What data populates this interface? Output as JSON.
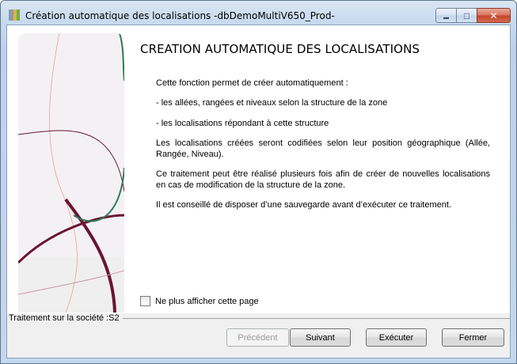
{
  "window": {
    "title": "Création automatique des localisations -dbDemoMultiV650_Prod-",
    "controls": {
      "minimize": "▬",
      "maximize": "□",
      "close": "✕"
    }
  },
  "content": {
    "heading": "CREATION AUTOMATIQUE DES LOCALISATIONS",
    "paragraphs": [
      "Cette fonction permet de créer automatiquement :",
      "- les allées, rangées et niveaux selon la structure de la zone",
      "- les localisations répondant à cette structure",
      "Les localisations créées seront codifiées selon leur position géographique (Allée, Rangée, Niveau).",
      "Ce traitement peut être réalisé plusieurs fois afin de créer de nouvelles localisations en cas de modification de la structure de la zone.",
      "Il est conseillé de disposer d’une sauvegarde avant d’exécuter ce traitement."
    ],
    "checkbox_label": "Ne plus afficher cette page",
    "checkbox_checked": false
  },
  "footer": {
    "company_label": "Traitement sur la société :S2"
  },
  "buttons": {
    "previous": "Précédent",
    "next": "Suivant",
    "execute": "Exécuter",
    "close": "Fermer"
  },
  "colors": {
    "curve_dark_red": "#6b1530",
    "curve_green": "#2f7a5a",
    "curve_salmon": "#e8a48f",
    "curve_rose": "#c99aa6"
  }
}
